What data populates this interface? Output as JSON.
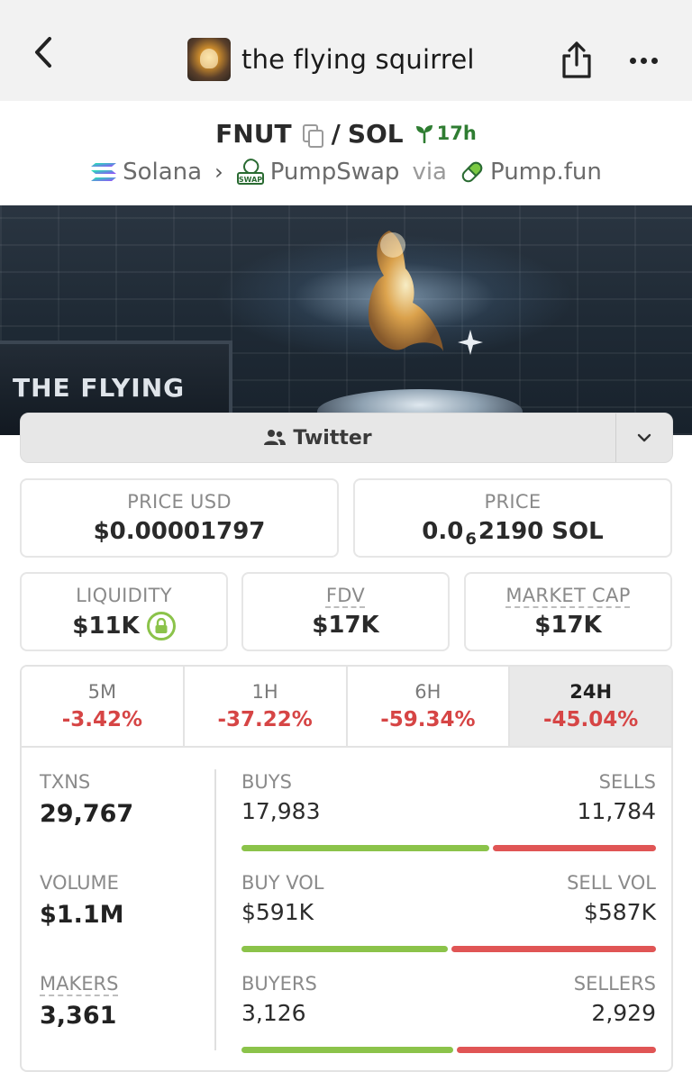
{
  "header": {
    "title": "the flying squirrel",
    "back_icon": "chevron-left-icon",
    "share_icon": "share-icon",
    "more_icon": "ellipsis-icon"
  },
  "pair": {
    "base": "FNUT",
    "separator": "/",
    "quote": "SOL",
    "age": "17h"
  },
  "chain": {
    "network": "Solana",
    "dex": "PumpSwap",
    "via_label": "via",
    "launchpad": "Pump.fun"
  },
  "banner": {
    "sign_text": "THE FLYING"
  },
  "socials": {
    "twitter_label": "Twitter"
  },
  "stats": {
    "price_usd": {
      "label": "PRICE USD",
      "value": "$0.00001797"
    },
    "price": {
      "label": "PRICE",
      "prefix": "0.0",
      "zeros": "6",
      "suffix": "2190 SOL"
    },
    "liquidity": {
      "label": "LIQUIDITY",
      "value": "$11K"
    },
    "fdv": {
      "label": "FDV",
      "value": "$17K"
    },
    "market_cap": {
      "label": "MARKET CAP",
      "value": "$17K"
    }
  },
  "timeframes": [
    {
      "label": "5M",
      "change": "-3.42%"
    },
    {
      "label": "1H",
      "change": "-37.22%"
    },
    {
      "label": "6H",
      "change": "-59.34%"
    },
    {
      "label": "24H",
      "change": "-45.04%",
      "active": true
    }
  ],
  "metrics": {
    "txns": {
      "label": "TXNS",
      "value": "29,767"
    },
    "volume": {
      "label": "VOLUME",
      "value": "$1.1M"
    },
    "makers": {
      "label": "MAKERS",
      "value": "3,361"
    },
    "buys": {
      "left_label": "BUYS",
      "right_label": "SELLS",
      "left_value": "17,983",
      "right_value": "11,784",
      "buy_fraction": 0.604
    },
    "buy_vol": {
      "left_label": "BUY VOL",
      "right_label": "SELL VOL",
      "left_value": "$591K",
      "right_value": "$587K",
      "buy_fraction": 0.502
    },
    "buyers": {
      "left_label": "BUYERS",
      "right_label": "SELLERS",
      "left_value": "3,126",
      "right_value": "2,929",
      "buy_fraction": 0.516
    }
  },
  "colors": {
    "positive": "#8bc34a",
    "negative": "#e05555",
    "age_green": "#2f7d32"
  }
}
